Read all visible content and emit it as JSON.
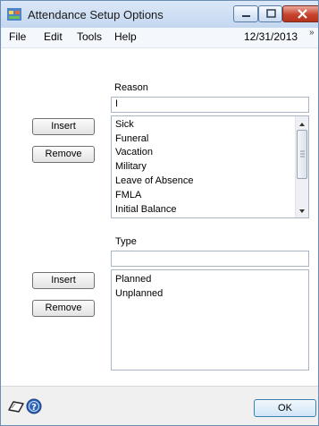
{
  "window": {
    "title": "Attendance Setup Options",
    "controls": {
      "minimize": "minimize",
      "maximize": "maximize",
      "close": "close"
    }
  },
  "menu": {
    "items": [
      "File",
      "Edit",
      "Tools",
      "Help"
    ],
    "date": "12/31/2013",
    "overflow": "»"
  },
  "reason": {
    "label": "Reason",
    "input_value": "I",
    "insert_label": "Insert",
    "remove_label": "Remove",
    "items": [
      "Sick",
      "Funeral",
      "Vacation",
      "Military",
      "Leave of Absence",
      "FMLA",
      "Initial Balance"
    ]
  },
  "type": {
    "label": "Type",
    "input_value": "",
    "insert_label": "Insert",
    "remove_label": "Remove",
    "items": [
      "Planned",
      "Unplanned"
    ]
  },
  "footer": {
    "ok_label": "OK",
    "icons": [
      "pencil-note-icon",
      "help-icon"
    ]
  }
}
